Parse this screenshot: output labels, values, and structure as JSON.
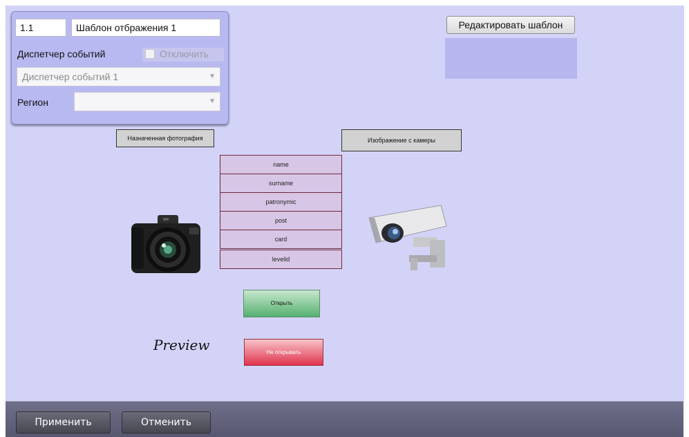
{
  "settings": {
    "id_value": "1.1",
    "template_name": "Шаблон отбражения 1",
    "event_dispatcher_label": "Диспетчер событий",
    "disable_label": "Отключить",
    "dispatcher_select": "Диспетчер событий 1",
    "region_label": "Регион",
    "region_select": ""
  },
  "edit_template_label": "Редактировать шаблон",
  "template": {
    "assigned_photo_label": "Назначенная фотография",
    "camera_image_label": "Изображение с камеры",
    "fields": [
      "name",
      "surname",
      "patronymic",
      "post",
      "card",
      "levelid"
    ],
    "open_label": "Открыть",
    "dont_open_label": "Не открывать",
    "preview_label": "Preview"
  },
  "footer": {
    "apply_label": "Применить",
    "cancel_label": "Отменить"
  },
  "icons": {
    "photo": "photo-camera-icon",
    "cctv": "cctv-camera-icon",
    "dropdown": "chevron-down-icon"
  },
  "colors": {
    "canvas": "#d3d3f8",
    "panel": "#b9b9f2",
    "open_button": "#55b070",
    "dont_open_button": "#e0344d"
  }
}
